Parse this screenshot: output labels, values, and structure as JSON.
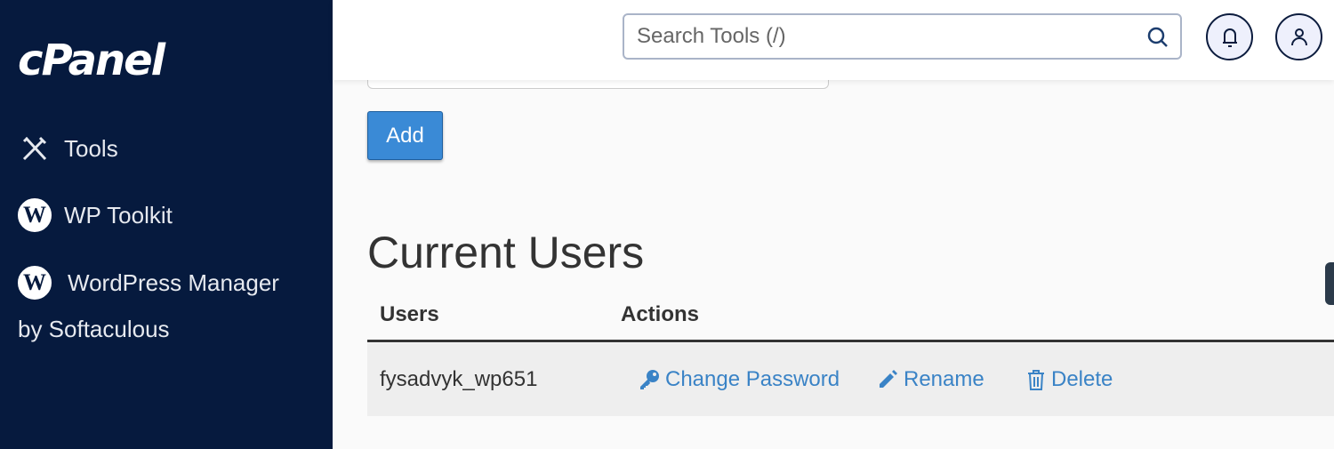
{
  "sidebar": {
    "logo": "cPanel",
    "items": [
      {
        "label": "Tools",
        "icon": "tools-icon"
      },
      {
        "label": "WP Toolkit",
        "icon": "wordpress-icon"
      },
      {
        "label": "WordPress Manager",
        "icon": "wordpress-icon"
      }
    ],
    "sub_label": "by Softaculous"
  },
  "header": {
    "search_placeholder": "Search Tools (/)"
  },
  "form": {
    "add_label": "Add"
  },
  "users": {
    "title": "Current Users",
    "col_users": "Users",
    "col_actions": "Actions",
    "rows": [
      {
        "name": "fysadvyk_wp651",
        "change_password": "Change Password",
        "rename": "Rename",
        "delete": "Delete"
      }
    ]
  },
  "colors": {
    "sidebar": "#061a3e",
    "accent": "#3a8ad6",
    "link": "#3a83c6"
  }
}
